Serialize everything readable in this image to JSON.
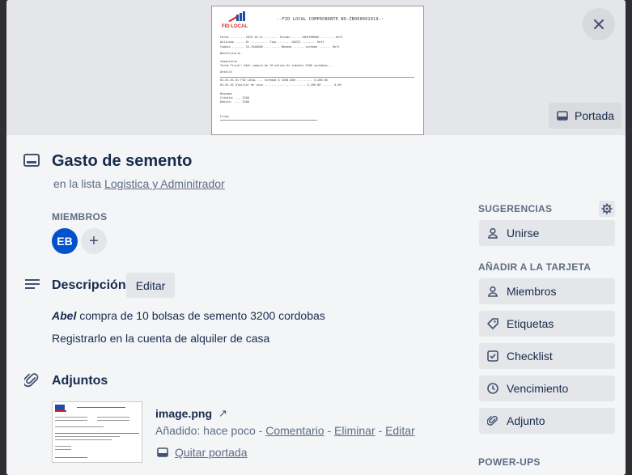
{
  "cover": {
    "doc_title": "--FID LOCAL COMPROBANTE NO-ZB000001019--",
    "logo_text": "FID LOCAL",
    "set_cover_label": "Portada"
  },
  "card": {
    "title": "Gasto de semento",
    "list_prefix": "en la lista",
    "list_name": "Logistica y Adminitrador"
  },
  "members": {
    "label": "MIEMBROS",
    "avatar_initials": "EB",
    "add_label": "+"
  },
  "description": {
    "title": "Descripción",
    "edit_label": "Editar",
    "line1_bold": "Abel",
    "line1_rest": " compra de 10 bolsas de semento 3200 cordobas",
    "line2": "Registrarlo en la cuenta de alquiler de casa"
  },
  "attachments": {
    "title": "Adjuntos",
    "file_name": "image.png",
    "added_text": "Añadido: hace poco",
    "sep": " - ",
    "comment": "Comentario",
    "delete": "Eliminar",
    "edit": "Editar",
    "remove_cover": "Quitar portada"
  },
  "sidebar": {
    "suggestions_label": "SUGERENCIAS",
    "join_label": "Unirse",
    "add_to_card_label": "AÑADIR A LA TARJETA",
    "members_btn": "Miembros",
    "labels_btn": "Etiquetas",
    "checklist_btn": "Checklist",
    "due_btn": "Vencimiento",
    "attachment_btn": "Adjunto",
    "powerups_label": "POWER-UPS"
  }
}
